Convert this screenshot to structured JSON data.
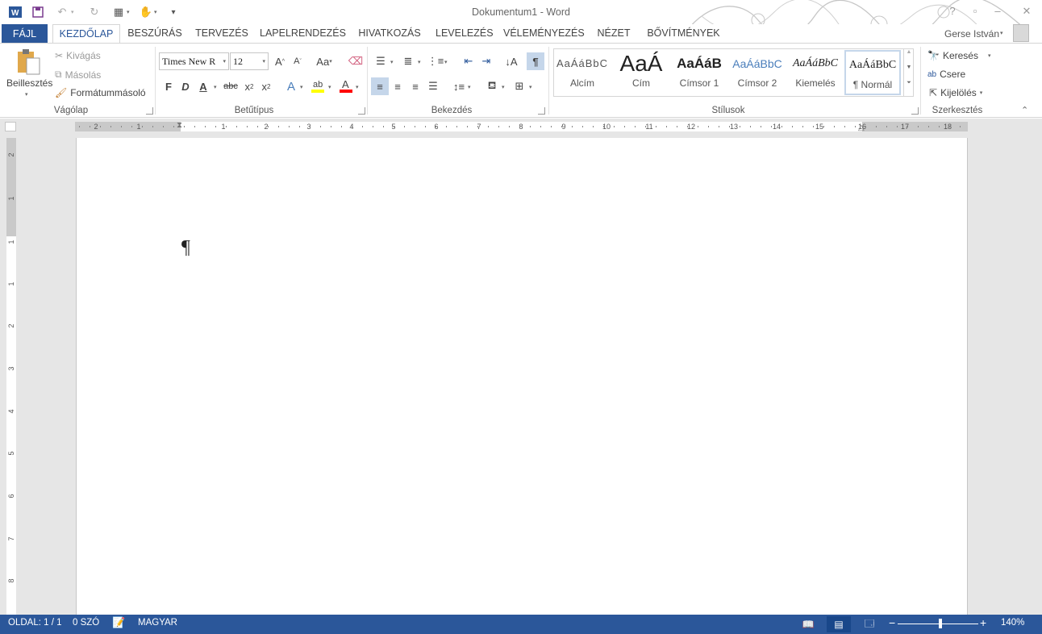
{
  "window": {
    "title": "Dokumentum1 - Word",
    "user": "Gerse István"
  },
  "qat": {
    "icons": [
      "word-app-icon",
      "save-icon",
      "undo-icon",
      "redo-icon",
      "layout-icon",
      "touch-mode-icon",
      "customize-qat-icon"
    ]
  },
  "tabs": {
    "file": "FÁJL",
    "items": [
      "KEZDŐLAP",
      "BESZÚRÁS",
      "TERVEZÉS",
      "LAPELRENDEZÉS",
      "HIVATKOZÁS",
      "LEVELEZÉS",
      "VÉLEMÉNYEZÉS",
      "NÉZET",
      "BŐVÍTMÉNYEK"
    ]
  },
  "clipboard": {
    "paste": "Beillesztés",
    "cut": "Kivágás",
    "copy": "Másolás",
    "format_painter": "Formátummásoló",
    "label": "Vágólap"
  },
  "font": {
    "name": "Times New R",
    "size": "12",
    "label": "Betűtípus",
    "bold": "F",
    "italic": "D",
    "underline": "A",
    "strike": "abc",
    "change_case": "Aa"
  },
  "paragraph": {
    "label": "Bekezdés"
  },
  "styles": {
    "label": "Stílusok",
    "items": [
      {
        "preview": "AaÁáBbC",
        "name": "Alcím"
      },
      {
        "preview": "AaÁ",
        "name": "Cím"
      },
      {
        "preview": "AaÁáB",
        "name": "Címsor 1"
      },
      {
        "preview": "AaÁáBbC",
        "name": "Címsor 2"
      },
      {
        "preview": "AaÁáBbC",
        "name": "Kiemelés"
      },
      {
        "preview": "AaÁáBbC",
        "name": "¶ Normál"
      }
    ]
  },
  "editing": {
    "find": "Keresés",
    "replace": "Csere",
    "select": "Kijelölés",
    "label": "Szerkesztés"
  },
  "ruler": {
    "h_labels": [
      "2",
      "1",
      "1",
      "2",
      "3",
      "4",
      "5",
      "6",
      "7",
      "8",
      "9",
      "10",
      "11",
      "12",
      "13",
      "14",
      "15",
      "16",
      "17",
      "18"
    ],
    "v_labels": [
      "2",
      "1",
      "1",
      "1",
      "2",
      "3",
      "4",
      "5",
      "6",
      "7",
      "8"
    ]
  },
  "document": {
    "pilcrow": "¶"
  },
  "status": {
    "page": "OLDAL: 1 / 1",
    "words": "0 SZÓ",
    "language": "MAGYAR",
    "zoom": "140%",
    "zoom_level_percent": 140
  },
  "colors": {
    "brand": "#2b579a",
    "highlight": "#ffff00",
    "font_color": "#ff0000"
  }
}
